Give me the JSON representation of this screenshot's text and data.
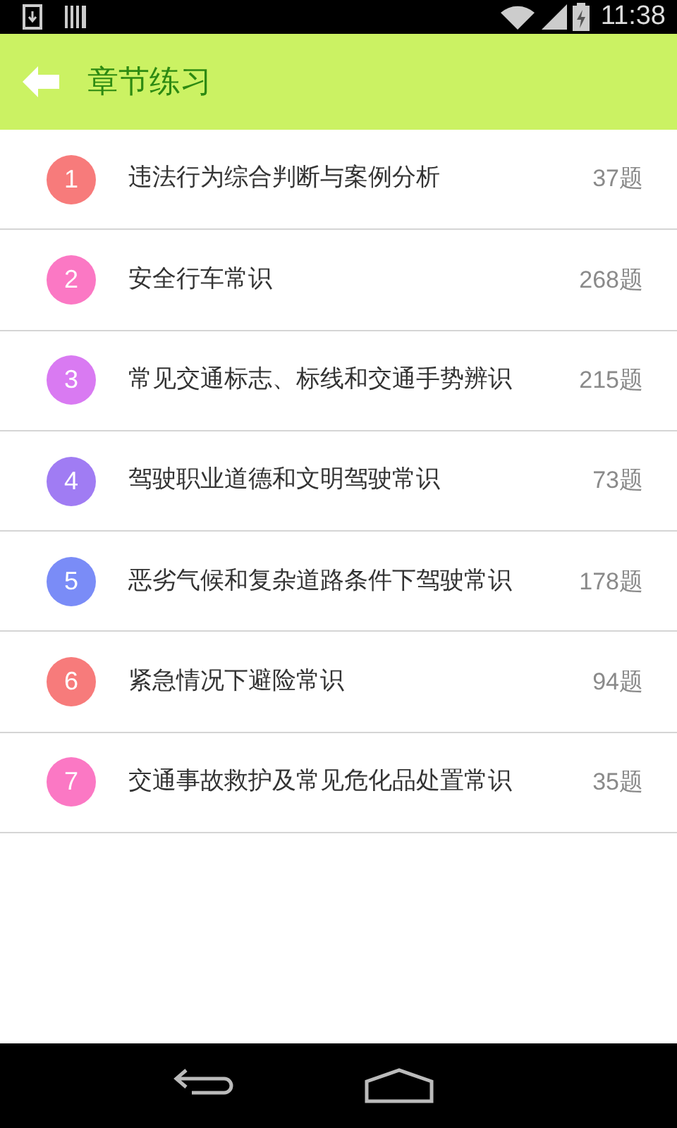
{
  "status_bar": {
    "time": "11:38"
  },
  "header": {
    "title": "章节练习"
  },
  "chapters": [
    {
      "number": "1",
      "title": "违法行为综合判断与案例分析",
      "count": "37题",
      "color": "#f77b7b"
    },
    {
      "number": "2",
      "title": "安全行车常识",
      "count": "268题",
      "color": "#fb78c4"
    },
    {
      "number": "3",
      "title": "常见交通标志、标线和交通手势辨识",
      "count": "215题",
      "color": "#d97af2"
    },
    {
      "number": "4",
      "title": "驾驶职业道德和文明驾驶常识",
      "count": "73题",
      "color": "#a07cf3"
    },
    {
      "number": "5",
      "title": "恶劣气候和复杂道路条件下驾驶常识",
      "count": "178题",
      "color": "#7a8cf7"
    },
    {
      "number": "6",
      "title": "紧急情况下避险常识",
      "count": "94题",
      "color": "#f77b7b"
    },
    {
      "number": "7",
      "title": "交通事故救护及常见危化品处置常识",
      "count": "35题",
      "color": "#fb78c4"
    }
  ]
}
